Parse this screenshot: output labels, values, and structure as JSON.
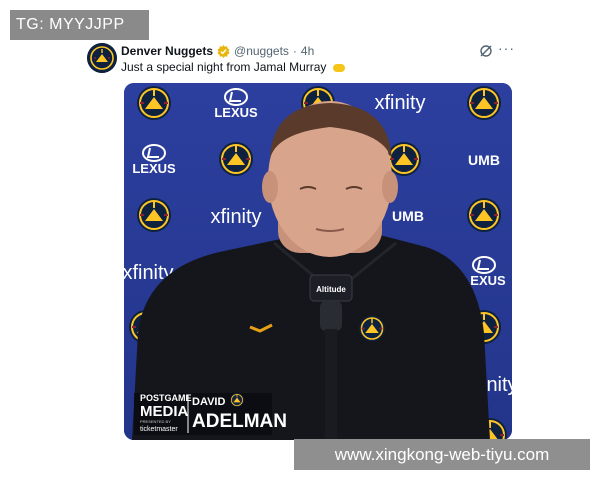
{
  "overlay_tag": "TG: MYYJJPP",
  "tweet": {
    "author_name": "Denver Nuggets",
    "handle": "@nuggets",
    "separator": "·",
    "time": "4h",
    "more_label": "···",
    "text": "Just a special night from Jamal Murray"
  },
  "media": {
    "sponsor_xfinity": "xfinity",
    "sponsor_lexus": "LEXUS",
    "sponsor_umb": "UMB",
    "mic_brand": "Altitude",
    "lower_third": {
      "show_line1": "POSTGAME",
      "show_line2": "MEDIA",
      "presented_by": "PRESENTED BY",
      "presenter": "ticketmaster",
      "first_name": "DAVID",
      "last_name": "ADELMAN"
    }
  },
  "watermark_url": "www.xingkong-web-tiyu.com",
  "colors": {
    "backdrop_blue": "#2a3d9c",
    "nuggets_navy": "#0e2240",
    "nuggets_gold": "#fec524",
    "verified_gold": "#e8b60b"
  },
  "icons": {
    "verified": "verified-badge-icon",
    "grok": "grok-icon",
    "more": "more-icon",
    "handshake": "handshake-emoji-icon"
  }
}
